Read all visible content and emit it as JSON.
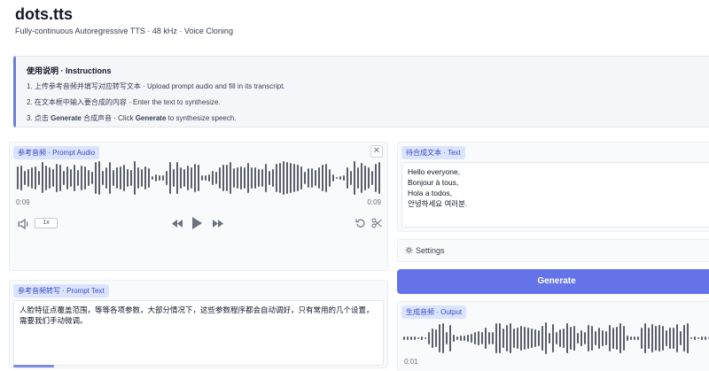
{
  "app": {
    "title": "dots.tts",
    "subtitle": "Fully-continuous Autoregressive TTS · 48 kHz · Voice Cloning"
  },
  "instructions": {
    "heading": "使用说明 · Instructions",
    "step1": "1. 上传参考音频并填写对应转写文本 · Upload prompt audio and fill in its transcript.",
    "step2": "2. 在文本框中输入要合成的内容 · Enter the text to synthesize.",
    "step3_prefix": "3. 点击 ",
    "step3_gen1": "Generate",
    "step3_mid": " 合成声音 · Click ",
    "step3_gen2": "Generate",
    "step3_suffix": " to synthesize speech."
  },
  "prompt_audio": {
    "label": "参考音频 · Prompt Audio",
    "close": "✕",
    "time_current": "0:09",
    "time_total": "0:09",
    "speed": "1x"
  },
  "prompt_text": {
    "label": "参考音频转写 · Prompt Text",
    "value": "人脸特征点覆盖范围，等等各项参数，大部分情况下，这些参数程序都会自动调好，只有常用的几个设置，需要我们手动微调。"
  },
  "synth_text": {
    "label": "待合成文本 · Text",
    "value": "Hello everyone,\nBonjour à tous,\nHola a todos,\n안녕하세요 여러분."
  },
  "settings": {
    "icon": "gear-icon",
    "label": "Settings"
  },
  "generate": {
    "label": "Generate"
  },
  "output": {
    "label": "生成音频 · Output",
    "time_current": "0:01"
  },
  "colors": {
    "accent": "#6474e8",
    "badge_bg": "#dbe4ff",
    "badge_text": "#3b4bbf"
  }
}
